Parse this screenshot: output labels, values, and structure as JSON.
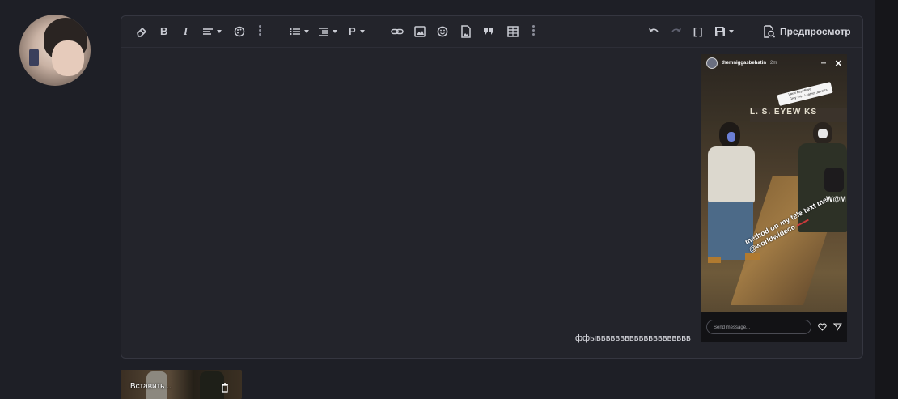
{
  "user": {
    "avatar_icon": "user-avatar"
  },
  "toolbar": {
    "left_groups": [
      [
        "eraser-icon",
        "bold-icon",
        "italic-icon",
        "text-align-icon",
        "palette-icon",
        "more-icon"
      ],
      [
        "list-icon",
        "indent-icon",
        "paragraph-icon"
      ],
      [
        "link-icon",
        "image-icon",
        "emoji-icon",
        "file-image-icon",
        "quote-icon",
        "table-icon",
        "more-icon"
      ]
    ],
    "bold_glyph": "B",
    "italic_glyph": "I",
    "paragraph_glyph": "P",
    "code_glyph": "[ ]",
    "right_icons": [
      "undo-icon",
      "redo-icon",
      "code-icon",
      "save-icon"
    ],
    "preview_label": "Предпросмотр"
  },
  "editor": {
    "text": "ффывввввввввввввввввввв"
  },
  "story": {
    "username": "themniggasbehatin",
    "ago": "2m",
    "dots": "···",
    "close": "✕",
    "sign": "L. S. EYEW   KS",
    "sticker_text": "Lax x Key Wave",
    "sticker_sub": "Grey 2% · Leather Jarrett's",
    "badge": "W@M",
    "caption": "method on my tele text me @worldwidecc",
    "send_placeholder": "Send message...",
    "colors": {
      "caption": "#ffffff",
      "accent_rule": "#c83a3a"
    }
  },
  "attachment": {
    "insert_label": "Вставить..."
  },
  "colors": {
    "page_bg": "#1e1f26",
    "editor_bg": "#23242b",
    "border": "#353640",
    "text": "#c9cbd3"
  }
}
